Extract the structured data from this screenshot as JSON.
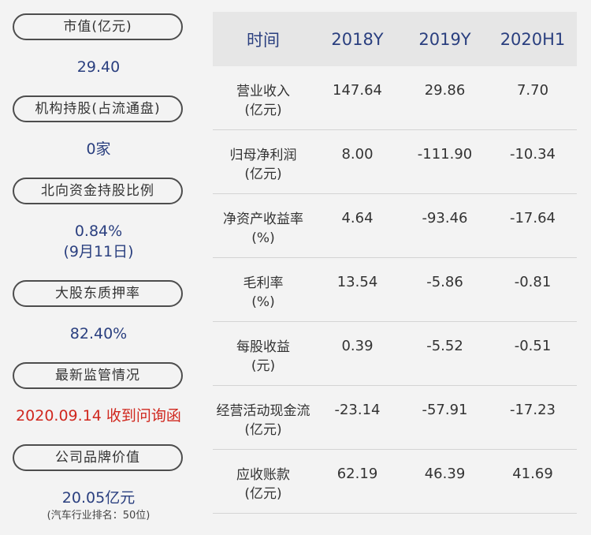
{
  "left": {
    "market_cap_label": "市值(亿元)",
    "market_cap_value": "29.40",
    "institution_label": "机构持股(占流通盘)",
    "institution_value": "0家",
    "northbound_label": "北向资金持股比例",
    "northbound_value": "0.84%",
    "northbound_date": "(9月11日)",
    "pledge_label": "大股东质押率",
    "pledge_value": "82.40%",
    "regulation_label": "最新监管情况",
    "regulation_value": "2020.09.14 收到问询函",
    "brand_label": "公司品牌价值",
    "brand_value": "20.05亿元",
    "brand_rank": "(汽车行业排名：50位)"
  },
  "colors": {
    "value_blue": "#2a3f7f",
    "alert_red": "#d0281f",
    "header_bg": "#e6e6e6"
  },
  "table": {
    "headers": [
      "时间",
      "2018Y",
      "2019Y",
      "2020H1"
    ],
    "rows": [
      {
        "label1": "营业收入",
        "label2": "(亿元)",
        "values": [
          "147.64",
          "29.86",
          "7.70"
        ]
      },
      {
        "label1": "归母净利润",
        "label2": "(亿元)",
        "values": [
          "8.00",
          "-111.90",
          "-10.34"
        ]
      },
      {
        "label1": "净资产收益率",
        "label2": "(%)",
        "values": [
          "4.64",
          "-93.46",
          "-17.64"
        ]
      },
      {
        "label1": "毛利率",
        "label2": "(%)",
        "values": [
          "13.54",
          "-5.86",
          "-0.81"
        ]
      },
      {
        "label1": "每股收益",
        "label2": "(元)",
        "values": [
          "0.39",
          "-5.52",
          "-0.51"
        ]
      },
      {
        "label1": "经营活动现金流",
        "label2": "(亿元)",
        "values": [
          "-23.14",
          "-57.91",
          "-17.23"
        ]
      },
      {
        "label1": "应收账款",
        "label2": "(亿元)",
        "values": [
          "62.19",
          "46.39",
          "41.69"
        ]
      }
    ]
  }
}
